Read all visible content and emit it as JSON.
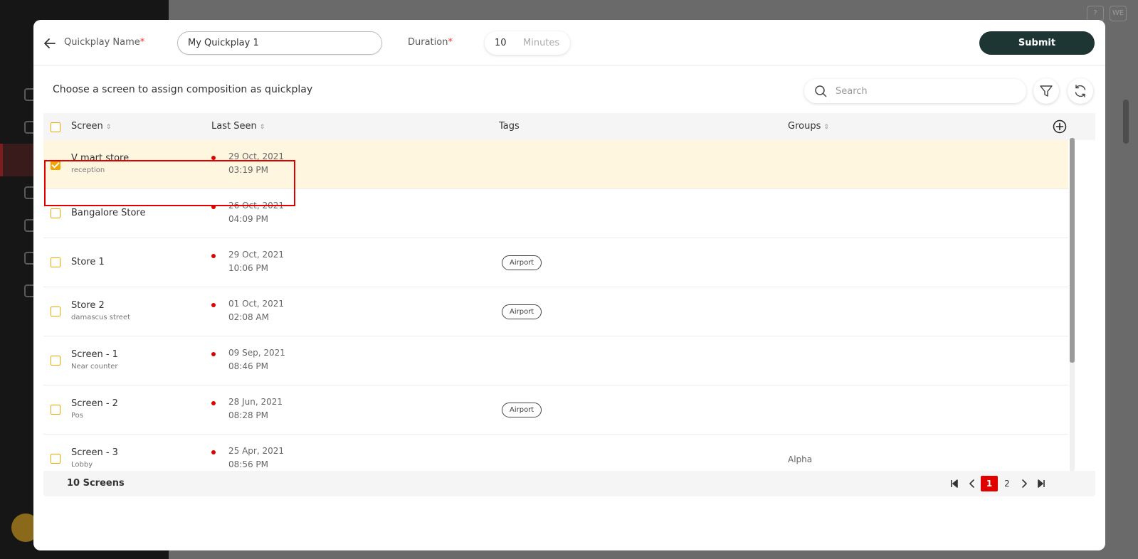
{
  "background": {
    "top_buttons": [
      "?",
      "WE"
    ]
  },
  "header": {
    "name_label": "Quickplay Name",
    "required_mark": "*",
    "name_value": "My Quickplay 1",
    "duration_label": "Duration",
    "duration_value": "10",
    "duration_unit": "Minutes",
    "submit_label": "Submit"
  },
  "toolbar": {
    "subtitle": "Choose a screen to assign composition as quickplay",
    "search_placeholder": "Search"
  },
  "table": {
    "columns": {
      "screen": "Screen",
      "last_seen": "Last Seen",
      "tags": "Tags",
      "groups": "Groups"
    },
    "rows": [
      {
        "name": "V mart store",
        "sub": "reception",
        "date": "29 Oct, 2021",
        "time": "03:19 PM",
        "tag": "",
        "group": "",
        "selected": true
      },
      {
        "name": "Bangalore Store",
        "sub": "",
        "date": "26 Oct, 2021",
        "time": "04:09 PM",
        "tag": "",
        "group": "",
        "selected": false
      },
      {
        "name": "Store 1",
        "sub": "",
        "date": "29 Oct, 2021",
        "time": "10:06 PM",
        "tag": "Airport",
        "group": "",
        "selected": false
      },
      {
        "name": "Store 2",
        "sub": "damascus street",
        "date": "01 Oct, 2021",
        "time": "02:08 AM",
        "tag": "Airport",
        "group": "",
        "selected": false
      },
      {
        "name": "Screen - 1",
        "sub": "Near counter",
        "date": "09 Sep, 2021",
        "time": "08:46 PM",
        "tag": "",
        "group": "",
        "selected": false
      },
      {
        "name": "Screen - 2",
        "sub": "Pos",
        "date": "28 Jun, 2021",
        "time": "08:28 PM",
        "tag": "Airport",
        "group": "",
        "selected": false
      },
      {
        "name": "Screen - 3",
        "sub": "Lobby",
        "date": "25 Apr, 2021",
        "time": "08:56 PM",
        "tag": "",
        "group": "Alpha",
        "selected": false
      }
    ]
  },
  "footer": {
    "count": "10 Screens",
    "pages": [
      "1",
      "2"
    ],
    "current_page": "1"
  },
  "colors": {
    "accent": "#f0a500",
    "status_offline": "#e00000",
    "submit_bg": "#1d3533",
    "selected_row": "#fff6e0"
  }
}
